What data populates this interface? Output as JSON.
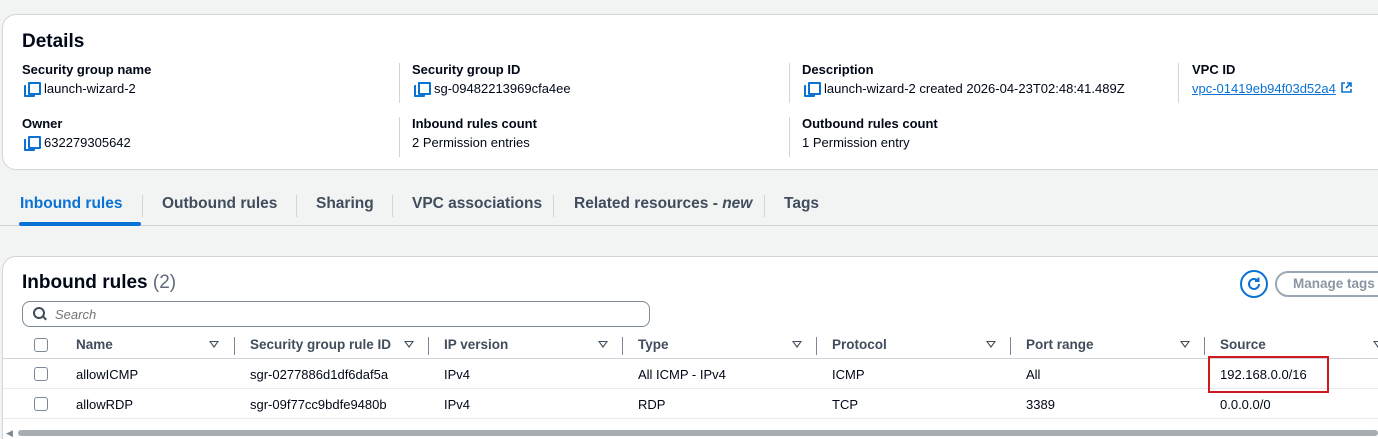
{
  "details": {
    "title": "Details",
    "fields": {
      "sg_name": {
        "label": "Security group name",
        "value": "launch-wizard-2"
      },
      "sg_id": {
        "label": "Security group ID",
        "value": "sg-09482213969cfa4ee"
      },
      "description": {
        "label": "Description",
        "value": "launch-wizard-2 created 2026-04-23T02:48:41.489Z"
      },
      "vpc_id": {
        "label": "VPC ID",
        "value": "vpc-01419eb94f03d52a4"
      },
      "owner": {
        "label": "Owner",
        "value": "632279305642"
      },
      "inbound_count": {
        "label": "Inbound rules count",
        "value": "2 Permission entries"
      },
      "outbound_count": {
        "label": "Outbound rules count",
        "value": "1 Permission entry"
      }
    }
  },
  "tabs": [
    {
      "label": "Inbound rules",
      "active": true
    },
    {
      "label": "Outbound rules"
    },
    {
      "label": "Sharing"
    },
    {
      "label": "VPC associations"
    },
    {
      "label": "Related resources - ",
      "badge": "new"
    },
    {
      "label": "Tags"
    }
  ],
  "rules": {
    "title": "Inbound rules",
    "count": "(2)",
    "manage_tags_label": "Manage tags",
    "search_placeholder": "Search",
    "columns": [
      "Name",
      "Security group rule ID",
      "IP version",
      "Type",
      "Protocol",
      "Port range",
      "Source"
    ],
    "rows": [
      {
        "name": "allowICMP",
        "rule_id": "sgr-0277886d1df6daf5a",
        "ip_version": "IPv4",
        "type": "All ICMP - IPv4",
        "protocol": "ICMP",
        "port_range": "All",
        "source": "192.168.0.0/16"
      },
      {
        "name": "allowRDP",
        "rule_id": "sgr-09f77cc9bdfe9480b",
        "ip_version": "IPv4",
        "type": "RDP",
        "protocol": "TCP",
        "port_range": "3389",
        "source": "0.0.0.0/0"
      }
    ]
  },
  "colors": {
    "accent": "#0972d3",
    "highlight": "#d0191f"
  },
  "icons": [
    "copy-icon",
    "external-link-icon",
    "refresh-icon",
    "search-icon",
    "sort-icon",
    "checkbox"
  ]
}
